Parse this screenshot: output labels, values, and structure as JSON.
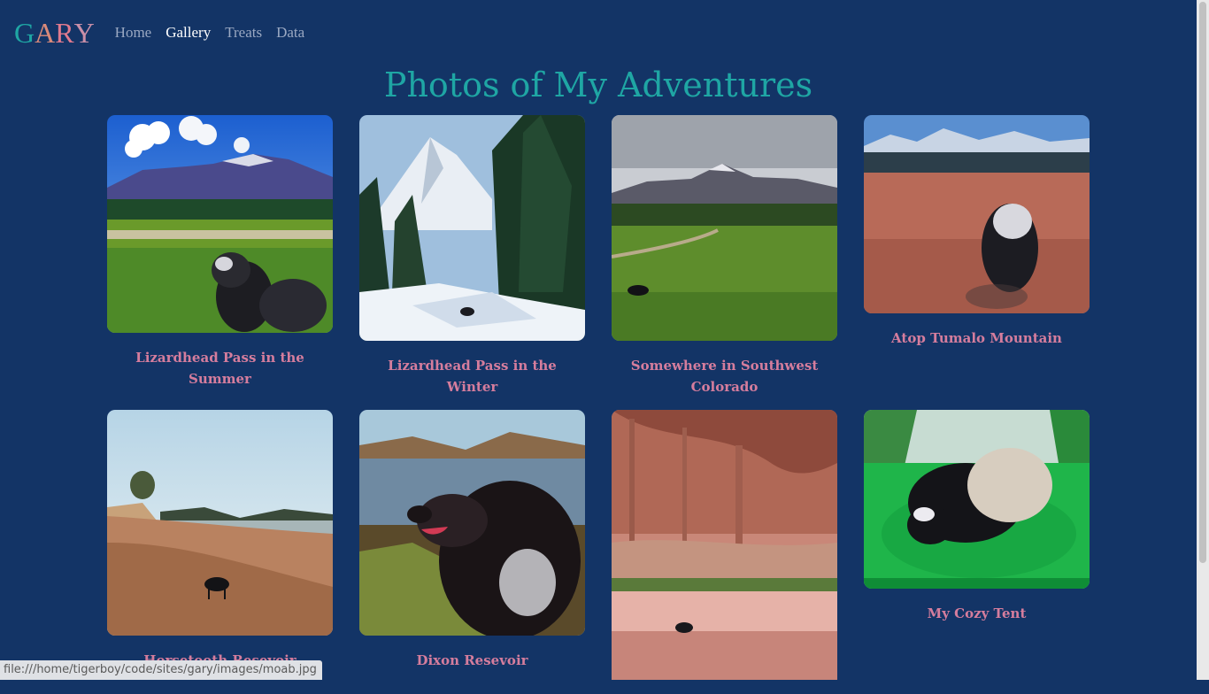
{
  "nav": {
    "logo_letters": [
      {
        "char": "G",
        "color": "#1fa6a4"
      },
      {
        "char": "A",
        "color": "#d8897a"
      },
      {
        "char": "R",
        "color": "#e07a8e"
      },
      {
        "char": "Y",
        "color": "#c98fa8"
      }
    ],
    "links": [
      {
        "label": "Home",
        "active": false
      },
      {
        "label": "Gallery",
        "active": true
      },
      {
        "label": "Treats",
        "active": false
      },
      {
        "label": "Data",
        "active": false
      }
    ]
  },
  "page": {
    "title": "Photos of My Adventures"
  },
  "gallery": [
    {
      "caption": "Lizardhead Pass in the Summer",
      "scene": "summer-meadow"
    },
    {
      "caption": "Lizardhead Pass in the Winter",
      "scene": "winter-snow"
    },
    {
      "caption": "Somewhere in Southwest Colorado",
      "scene": "green-valley"
    },
    {
      "caption": "Atop Tumalo Mountain",
      "scene": "red-summit"
    },
    {
      "caption": "Horsetooth Resevoir",
      "scene": "reservoir-beach"
    },
    {
      "caption": "Dixon Resevoir",
      "scene": "lake-portrait"
    },
    {
      "caption": "",
      "scene": "red-canyon"
    },
    {
      "caption": "My Cozy Tent",
      "scene": "tent-sleeping-bag"
    }
  ],
  "status_bar": {
    "url": "file:///home/tigerboy/code/sites/gary/images/moab.jpg"
  }
}
